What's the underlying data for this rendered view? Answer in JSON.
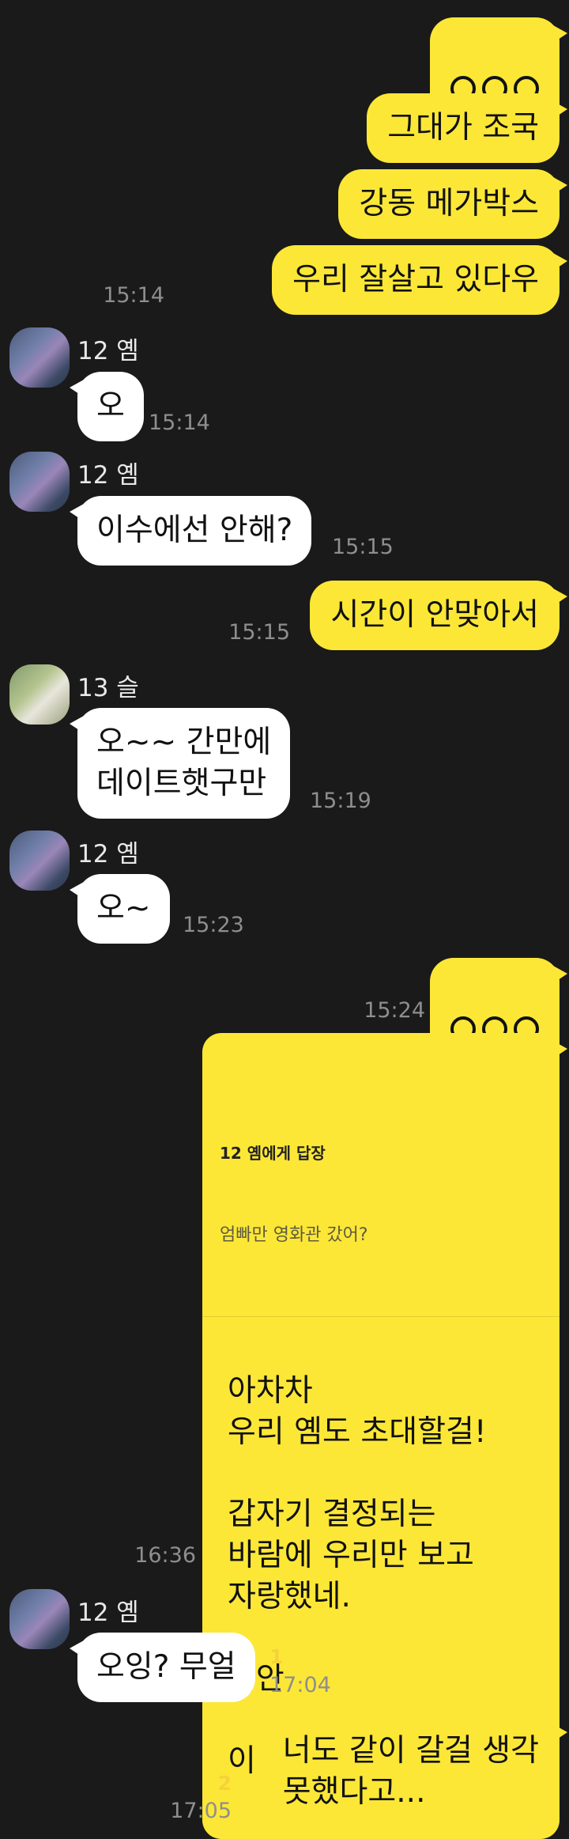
{
  "messages": {
    "m1": {
      "text": "ㅇㅇㅇ"
    },
    "m2": {
      "text": "그대가 조국"
    },
    "m3": {
      "text": "강동 메가박스"
    },
    "m4": {
      "text": "우리 잘살고 있다우",
      "time": "15:14"
    },
    "m5": {
      "sender": "12 옘",
      "text": "오",
      "time": "15:14"
    },
    "m6": {
      "sender": "12 옘",
      "text": "이수에선 안해?",
      "time": "15:15"
    },
    "m7": {
      "text": "시간이 안맞아서",
      "time": "15:15"
    },
    "m8": {
      "sender": "13 슬",
      "text": "오~~ 간만에\n데이트햇구만",
      "time": "15:19"
    },
    "m9": {
      "sender": "12 옘",
      "text": "오~",
      "time": "15:23"
    },
    "m10": {
      "text": "ㅇㅇㅇ",
      "time": "15:24"
    },
    "m11": {
      "reply_to": "12 옘에게 답장",
      "reply_preview": "엄빠만 영화관 갔어?",
      "text": "아차차\n우리 옘도 초대할걸!\n\n갑자기 결정되는\n바람에 우리만 보고\n자랑했네.\n\n미안\n\n이 다음에는 신경쓸게",
      "time": "16:36"
    },
    "m12": {
      "sender": "12 옘",
      "text": "오잉? 무얼",
      "unread": "1",
      "time": "17:04"
    },
    "m13": {
      "text": "너도 같이 갈걸 생각\n못했다고...",
      "unread": "2",
      "time": "17:05"
    }
  },
  "colors": {
    "background": "#1a1a1a",
    "my_bubble": "#fce737",
    "other_bubble": "#ffffff",
    "unread": "#f5d23a"
  }
}
